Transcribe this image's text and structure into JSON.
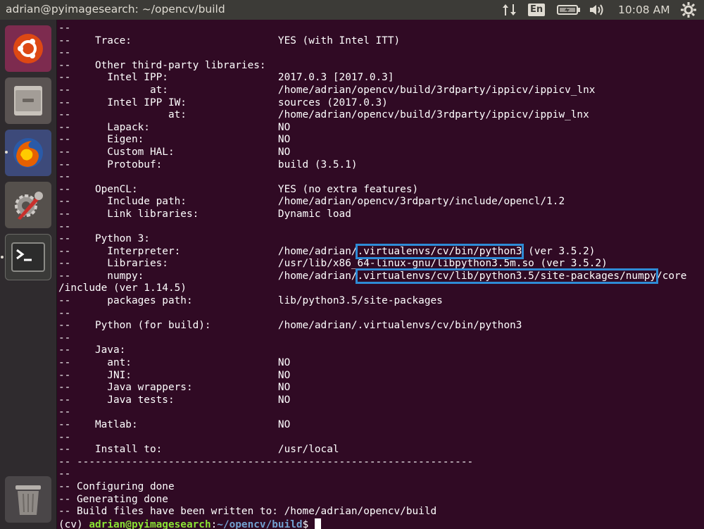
{
  "window": {
    "title": "adrian@pyimagesearch: ~/opencv/build"
  },
  "top_panel": {
    "language": "En",
    "clock": "10:08 AM",
    "icons": [
      "network-updown-icon",
      "battery-icon",
      "volume-icon",
      "settings-gear-icon"
    ]
  },
  "launcher": {
    "items": [
      {
        "name": "ubuntu-dash",
        "icon": "ubuntu-logo-icon"
      },
      {
        "name": "files",
        "icon": "file-cabinet-icon"
      },
      {
        "name": "firefox",
        "icon": "firefox-icon"
      },
      {
        "name": "system-settings",
        "icon": "settings-wrench-icon"
      },
      {
        "name": "terminal",
        "icon": "terminal-icon"
      },
      {
        "name": "trash",
        "icon": "trash-icon"
      }
    ]
  },
  "terminal": {
    "lines": [
      "--",
      "--    Trace:                        YES (with Intel ITT)",
      "--",
      "--    Other third-party libraries:",
      "--      Intel IPP:                  2017.0.3 [2017.0.3]",
      "--             at:                  /home/adrian/opencv/build/3rdparty/ippicv/ippicv_lnx",
      "--      Intel IPP IW:               sources (2017.0.3)",
      "--                at:               /home/adrian/opencv/build/3rdparty/ippicv/ippiw_lnx",
      "--      Lapack:                     NO",
      "--      Eigen:                      NO",
      "--      Custom HAL:                 NO",
      "--      Protobuf:                   build (3.5.1)",
      "--",
      "--    OpenCL:                       YES (no extra features)",
      "--      Include path:               /home/adrian/opencv/3rdparty/include/opencl/1.2",
      "--      Link libraries:             Dynamic load",
      "--",
      "--    Python 3:",
      "--      Interpreter:                /home/adrian/.virtualenvs/cv/bin/python3 (ver 3.5.2)",
      "--      Libraries:                  /usr/lib/x86_64-linux-gnu/libpython3.5m.so (ver 3.5.2)",
      "--      numpy:                      /home/adrian/.virtualenvs/cv/lib/python3.5/site-packages/numpy/core",
      "/include (ver 1.14.5)",
      "--      packages path:              lib/python3.5/site-packages",
      "--",
      "--    Python (for build):           /home/adrian/.virtualenvs/cv/bin/python3",
      "--",
      "--    Java:",
      "--      ant:                        NO",
      "--      JNI:                        NO",
      "--      Java wrappers:              NO",
      "--      Java tests:                 NO",
      "--",
      "--    Matlab:                       NO",
      "--",
      "--    Install to:                   /usr/local",
      "-- -----------------------------------------------------------------",
      "--",
      "-- Configuring done",
      "-- Generating done",
      "-- Build files have been written to: /home/adrian/opencv/build"
    ],
    "highlights": {
      "interpreter": {
        "before": "--      Interpreter:                /home/adrian/",
        "marked": ".virtualenvs/cv/bin/python3",
        "after": " (ver 3.5.2)"
      },
      "numpy": {
        "before": "--      numpy:                      /home/adrian/",
        "marked": ".virtualenvs/cv/lib/python3.5/site-packages/numpy",
        "after": "/core"
      }
    },
    "prompt": {
      "env": "(cv) ",
      "user_host": "adrian@pyimagesearch",
      "sep": ":",
      "path": "~/opencv/build",
      "symbol": "$ "
    },
    "highlight_color": "#2e8bd6"
  }
}
